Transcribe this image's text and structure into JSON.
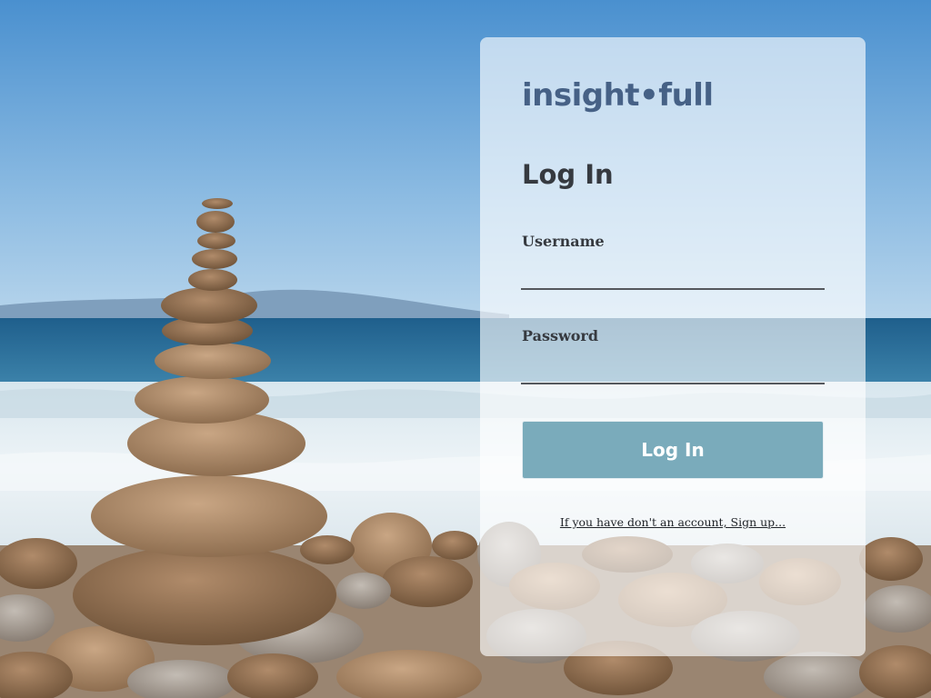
{
  "brand": {
    "logo_text": "insight•full",
    "logo_color": "#466186"
  },
  "login_form": {
    "title": "Log In",
    "username": {
      "label": "Username",
      "value": "",
      "placeholder": ""
    },
    "password": {
      "label": "Password",
      "value": "",
      "placeholder": ""
    },
    "submit_label": "Log In",
    "signup_link": "If you have don't an account, Sign up..."
  },
  "background": {
    "description_icon": "stacked-stones-beach-photo"
  },
  "colors": {
    "accent_button": "#7aabbb",
    "text_dark": "#363a40",
    "card_background": "rgba(255,255,255,0.64)"
  }
}
